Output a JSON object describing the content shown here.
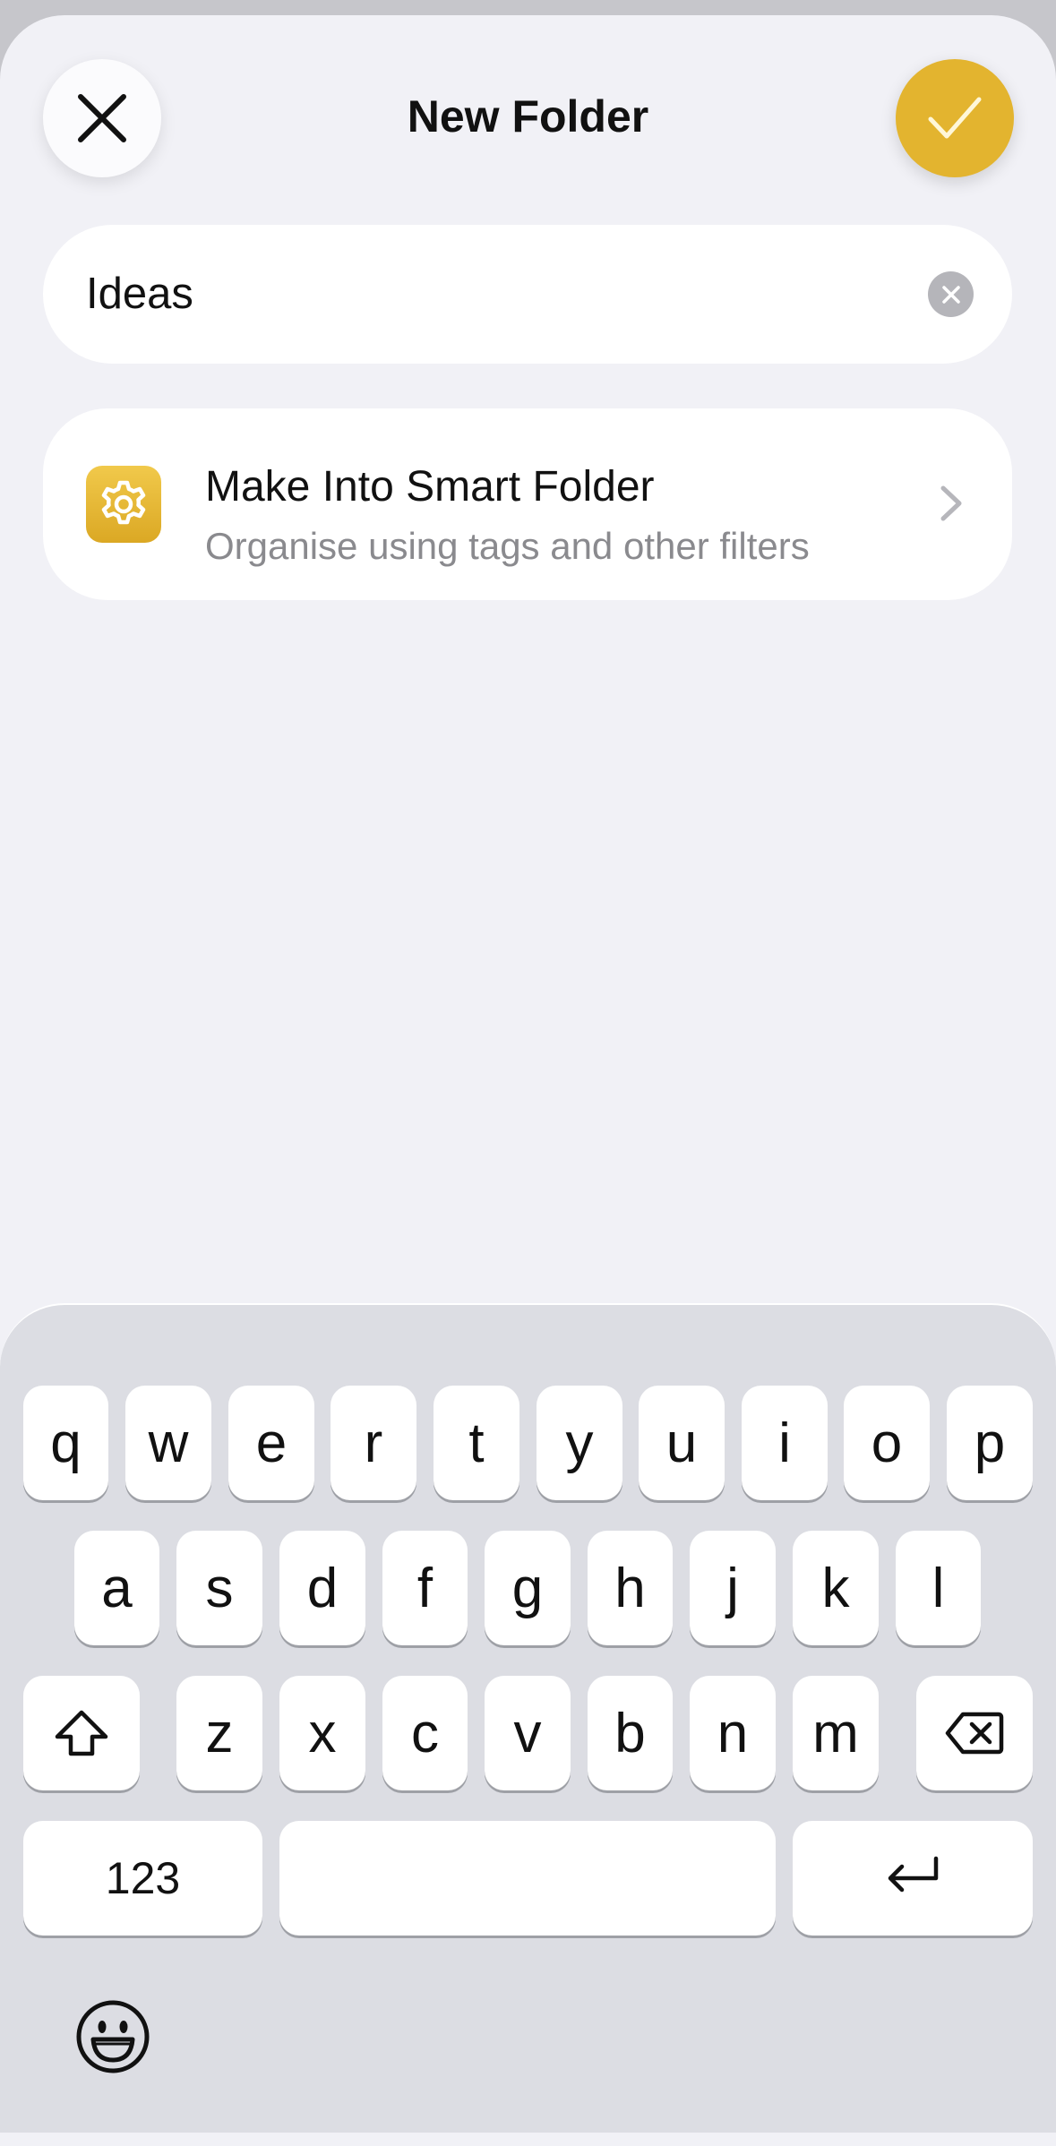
{
  "header": {
    "title": "New Folder",
    "close_icon": "close-icon",
    "confirm_icon": "checkmark-icon",
    "accent_color": "#e3b42f"
  },
  "name_field": {
    "value": "Ideas",
    "clear_icon": "clear-icon"
  },
  "smart_folder": {
    "title": "Make Into Smart Folder",
    "subtitle": "Organise using tags and other filters",
    "icon": "gear-icon"
  },
  "keyboard": {
    "row1": [
      "q",
      "w",
      "e",
      "r",
      "t",
      "y",
      "u",
      "i",
      "o",
      "p"
    ],
    "row2": [
      "a",
      "s",
      "d",
      "f",
      "g",
      "h",
      "j",
      "k",
      "l"
    ],
    "row3": [
      "z",
      "x",
      "c",
      "v",
      "b",
      "n",
      "m"
    ],
    "numbers_label": "123"
  }
}
